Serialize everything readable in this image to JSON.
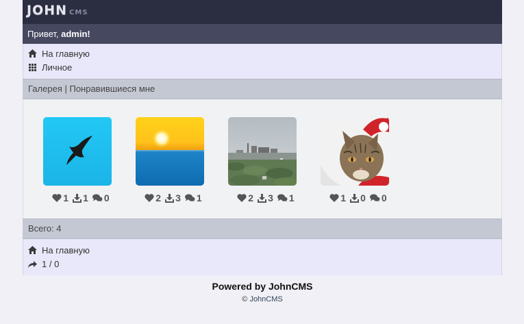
{
  "logo": {
    "main": "JOHN",
    "sub": "CMS"
  },
  "greeting": {
    "prefix": "Привет, ",
    "user": "admin!"
  },
  "top_menu": [
    {
      "label": "На главную",
      "icon": "home-icon"
    },
    {
      "label": "Личное",
      "icon": "grid-icon"
    }
  ],
  "breadcrumb": {
    "section": "Галерея",
    "separator": " | ",
    "page": "Понравившиеся мне"
  },
  "photos": [
    {
      "image": "bird-silhouette",
      "likes": "1",
      "downloads": "1",
      "comments": "0"
    },
    {
      "image": "sunset-sea",
      "likes": "2",
      "downloads": "3",
      "comments": "1"
    },
    {
      "image": "city-view",
      "likes": "2",
      "downloads": "3",
      "comments": "1"
    },
    {
      "image": "cat-santa-hat",
      "likes": "1",
      "downloads": "0",
      "comments": "0"
    }
  ],
  "total": "Всего: 4",
  "bottom_menu": [
    {
      "label": "На главную",
      "icon": "home-icon"
    },
    {
      "label": "1 / 0",
      "icon": "share-icon"
    }
  ],
  "footer": {
    "powered": "Powered by JohnCMS",
    "copy_symbol": "© ",
    "copy_link": "JohnCMS"
  },
  "colors": {
    "header": "#2b2d40",
    "greet_bar": "#46485f",
    "menu_bg": "#e8e8fa",
    "section_bar": "#c4c8d2"
  }
}
